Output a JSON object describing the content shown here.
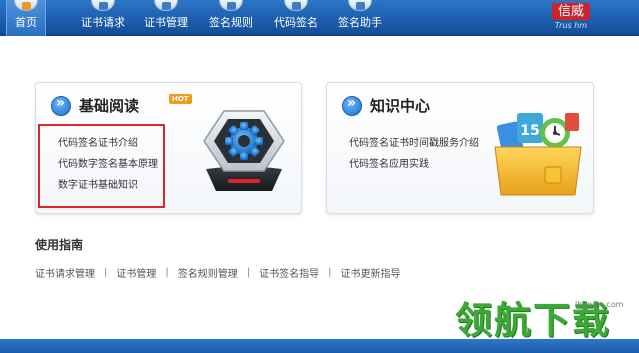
{
  "nav": {
    "items": [
      {
        "label": "首页"
      },
      {
        "label": "证书请求"
      },
      {
        "label": "证书管理"
      },
      {
        "label": "签名规则"
      },
      {
        "label": "代码签名"
      },
      {
        "label": "签名助手"
      }
    ],
    "active_index": 0,
    "logo_main": "信威",
    "logo_sub": "Trus   hm"
  },
  "panels": {
    "basic": {
      "title": "基础阅读",
      "badge": "HOT",
      "links": [
        "代码签名证书介绍",
        "代码数字签名基本原理",
        "数字证书基础知识"
      ],
      "icon": "gear-icon"
    },
    "knowledge": {
      "title": "知识中心",
      "links": [
        "代码签名证书时间戳服务介绍",
        "代码签名应用实践"
      ],
      "icon": "folder-apps-icon"
    }
  },
  "guide": {
    "title": "使用指南",
    "links": [
      "证书请求管理",
      "证书管理",
      "签名规则管理",
      "证书签名指导",
      "证书更新指导"
    ],
    "separator": "|"
  },
  "watermark": {
    "text": "领航下载",
    "url": "lhdown.com"
  },
  "colors": {
    "nav_bg": "#1d5fae",
    "accent_red": "#e3222b",
    "watermark_green": "#3aa935",
    "hot_orange": "#f29a1c"
  }
}
